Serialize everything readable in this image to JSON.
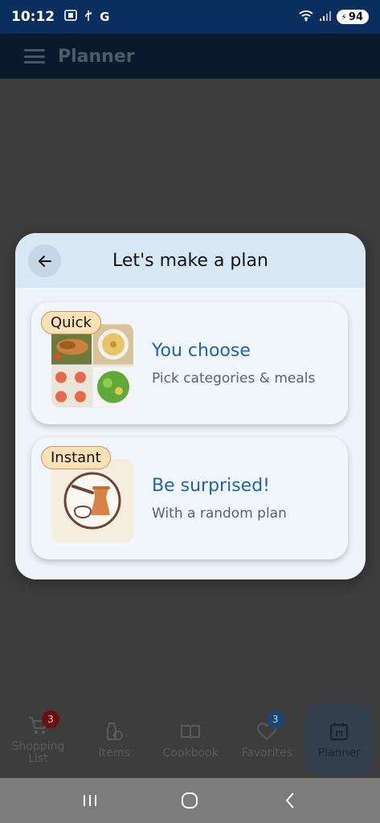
{
  "status_bar": {
    "time": "10:12",
    "carrier_letter": "G",
    "network": "6E",
    "battery": "94"
  },
  "app_bar": {
    "title": "Planner"
  },
  "dialog": {
    "title": "Let's make a plan",
    "options": [
      {
        "badge": "Quick",
        "title": "You choose",
        "subtitle": "Pick categories & meals",
        "image": "meal-collage"
      },
      {
        "badge": "Instant",
        "title": "Be surprised!",
        "subtitle": "With a random plan",
        "image": "coffee-pot"
      }
    ]
  },
  "bottom_nav": {
    "items": [
      {
        "label": "Shopping List",
        "icon": "cart-icon",
        "badge": "3"
      },
      {
        "label": "Items",
        "icon": "items-icon"
      },
      {
        "label": "Cookbook",
        "icon": "book-icon"
      },
      {
        "label": "Favorites",
        "icon": "heart-icon",
        "badge": "3"
      },
      {
        "label": "Planner",
        "icon": "calendar-icon"
      }
    ],
    "active": "Planner"
  },
  "colors": {
    "accent": "#1f64a8",
    "badge_bg": "#fbe2b6",
    "status_bar": "#0a2f5e"
  }
}
